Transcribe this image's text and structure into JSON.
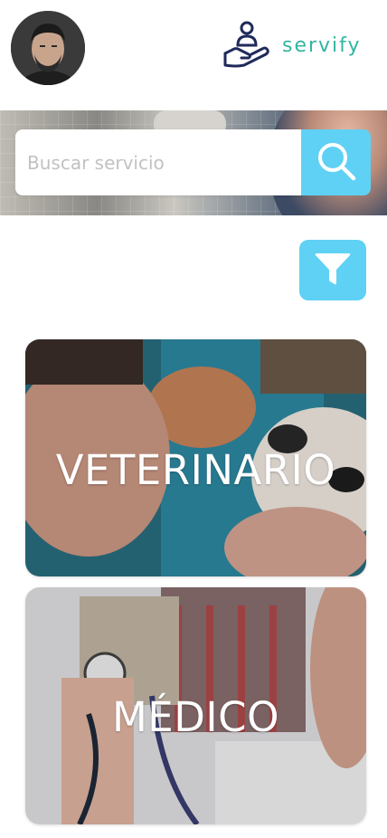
{
  "header": {
    "avatar_icon": "user-avatar",
    "logo_icon": "hand-holding-person-icon",
    "logo_text": "servify"
  },
  "search": {
    "placeholder": "Buscar servicio",
    "value": "",
    "button_icon": "search-icon"
  },
  "filter": {
    "icon": "filter-funnel-icon"
  },
  "categories": [
    {
      "label": "VETERINARIO"
    },
    {
      "label": "MÉDICO"
    }
  ],
  "colors": {
    "accent": "#5fd1f4",
    "brand_text": "#31b6a0",
    "logo_navy": "#1f2a5b",
    "background": "#ffffff"
  }
}
